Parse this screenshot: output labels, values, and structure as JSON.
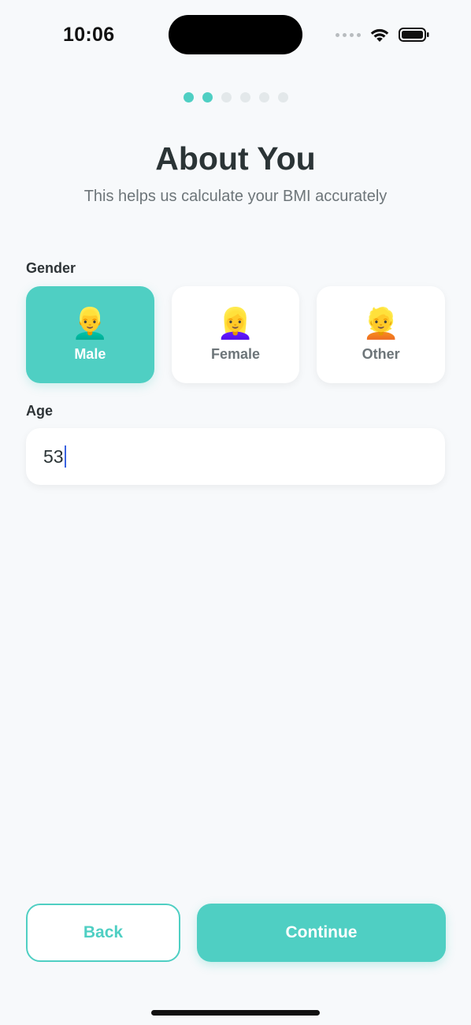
{
  "status": {
    "time": "10:06"
  },
  "progress": {
    "total": 6,
    "active": 2
  },
  "header": {
    "title": "About You",
    "subtitle": "This helps us calculate your BMI accurately"
  },
  "gender": {
    "label": "Gender",
    "options": [
      {
        "emoji": "👱‍♂️",
        "label": "Male",
        "selected": true
      },
      {
        "emoji": "👱‍♀️",
        "label": "Female",
        "selected": false
      },
      {
        "emoji": "👱",
        "label": "Other",
        "selected": false
      }
    ]
  },
  "age": {
    "label": "Age",
    "value": "53"
  },
  "actions": {
    "back_label": "Back",
    "continue_label": "Continue"
  },
  "colors": {
    "accent": "#4fcfc3",
    "background": "#f7f9fb",
    "text": "#2b3436",
    "muted": "#6d7579"
  },
  "icons": [
    "wifi-icon",
    "battery-icon",
    "cellular-signal-icon"
  ]
}
